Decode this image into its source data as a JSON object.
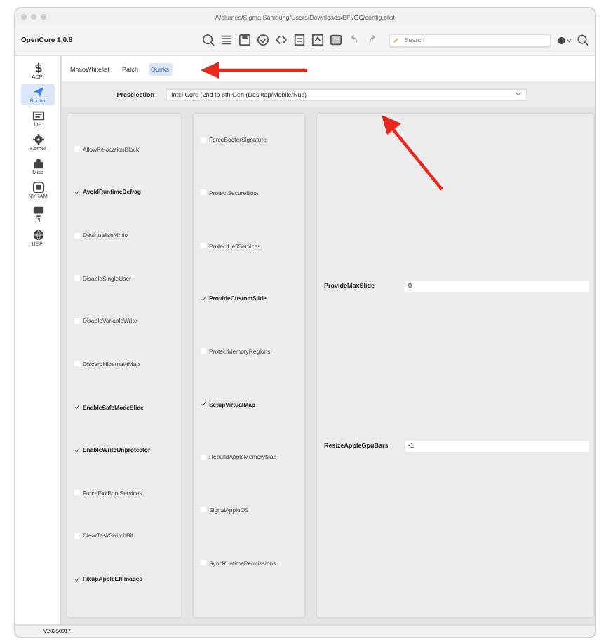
{
  "window": {
    "title": "/Volumes/Sigma Samsung/Users/Downloads/EFI/OC/config.plist"
  },
  "toolbar": {
    "app_version": "OpenCore 1.0.6",
    "search": {
      "placeholder": "Search"
    }
  },
  "sidebar": {
    "items": [
      {
        "label": "ACPI",
        "selected": false
      },
      {
        "label": "Booter",
        "selected": true
      },
      {
        "label": "DP",
        "selected": false
      },
      {
        "label": "Kernel",
        "selected": false
      },
      {
        "label": "Misc",
        "selected": false
      },
      {
        "label": "NVRAM",
        "selected": false
      },
      {
        "label": "PI",
        "selected": false
      },
      {
        "label": "UEFI",
        "selected": false
      }
    ]
  },
  "tabs": [
    {
      "label": "MmioWhitelist",
      "selected": false
    },
    {
      "label": "Patch",
      "selected": false
    },
    {
      "label": "Quirks",
      "selected": true
    }
  ],
  "preselection": {
    "label": "Preselection",
    "value": "Intel Core (2nd to 8th Gen (Desktop/Mobile/Nuc)"
  },
  "quirks_column_1": [
    {
      "label": "AllowRelocationBlock",
      "checked": false
    },
    {
      "label": "AvoidRuntimeDefrag",
      "checked": true
    },
    {
      "label": "DevirtualiseMmio",
      "checked": false
    },
    {
      "label": "DisableSingleUser",
      "checked": false
    },
    {
      "label": "DisableVariableWrite",
      "checked": false
    },
    {
      "label": "DiscardHibernateMap",
      "checked": false
    },
    {
      "label": "EnableSafeModeSlide",
      "checked": true
    },
    {
      "label": "EnableWriteUnprotector",
      "checked": true
    },
    {
      "label": "ForceExitBootServices",
      "checked": false
    },
    {
      "label": "ClearTaskSwitchBit",
      "checked": false
    },
    {
      "label": "FixupAppleEfiImages",
      "checked": true
    }
  ],
  "quirks_column_2": [
    {
      "label": "ForceBooterSignature",
      "checked": false
    },
    {
      "label": "ProtectSecureBoot",
      "checked": false
    },
    {
      "label": "ProtectUefiServices",
      "checked": false
    },
    {
      "label": "ProvideCustomSlide",
      "checked": true
    },
    {
      "label": "ProtectMemoryRegions",
      "checked": false
    },
    {
      "label": "SetupVirtualMap",
      "checked": true
    },
    {
      "label": "RebuildAppleMemoryMap",
      "checked": false
    },
    {
      "label": "SignalAppleOS",
      "checked": false
    },
    {
      "label": "SyncRuntimePermissions",
      "checked": false
    }
  ],
  "fields": [
    {
      "label": "ProvideMaxSlide",
      "value": "0"
    },
    {
      "label": "ResizeAppleGpuBars",
      "value": "-1"
    }
  ],
  "status_bar": {
    "text": "V20250917"
  }
}
